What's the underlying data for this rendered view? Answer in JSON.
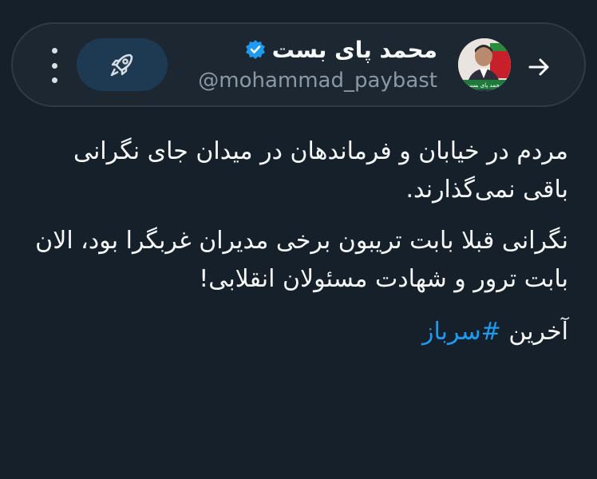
{
  "header": {
    "user_name": "محمد پای بست",
    "handle": "@mohammad_paybast",
    "verified": true,
    "back_icon": "arrow-right-icon",
    "boost_icon": "rocket-icon",
    "more_icon": "vertical-dots-icon",
    "avatar_caption": "محمد پای بست"
  },
  "tweet": {
    "paragraph_1": "مردم در خیابان و فرماندهان در میدان جای نگرانی باقی نمی‌گذارند.",
    "paragraph_2": "نگرانی قبلا بابت تریبون برخی مدیران غربگرا بود، الان بابت ترور و شهادت مسئولان انقلابی!",
    "last_line_prefix": "آخرین",
    "hashtag": "#سرباز"
  },
  "colors": {
    "background": "#15202b",
    "accent": "#1d9bf0",
    "boost_bg": "#1d3a52"
  }
}
